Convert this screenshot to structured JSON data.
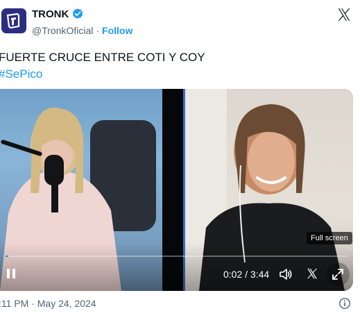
{
  "account": {
    "name": "TRONK",
    "handle": "@TronkOficial",
    "separator": "·",
    "follow_label": "Follow"
  },
  "tweet": {
    "text": "FUERTE CRUCE ENTRE COTI Y COY",
    "hashtag": "#SePico"
  },
  "video": {
    "time": "0:02 / 3:44",
    "progress": 0.009,
    "tooltip": "Full screen"
  },
  "footer": {
    "timestamp": ":11 PM · May 24, 2024"
  },
  "colors": {
    "accent": "#1d9bf0",
    "avatar_bg": "#2b2d83"
  }
}
